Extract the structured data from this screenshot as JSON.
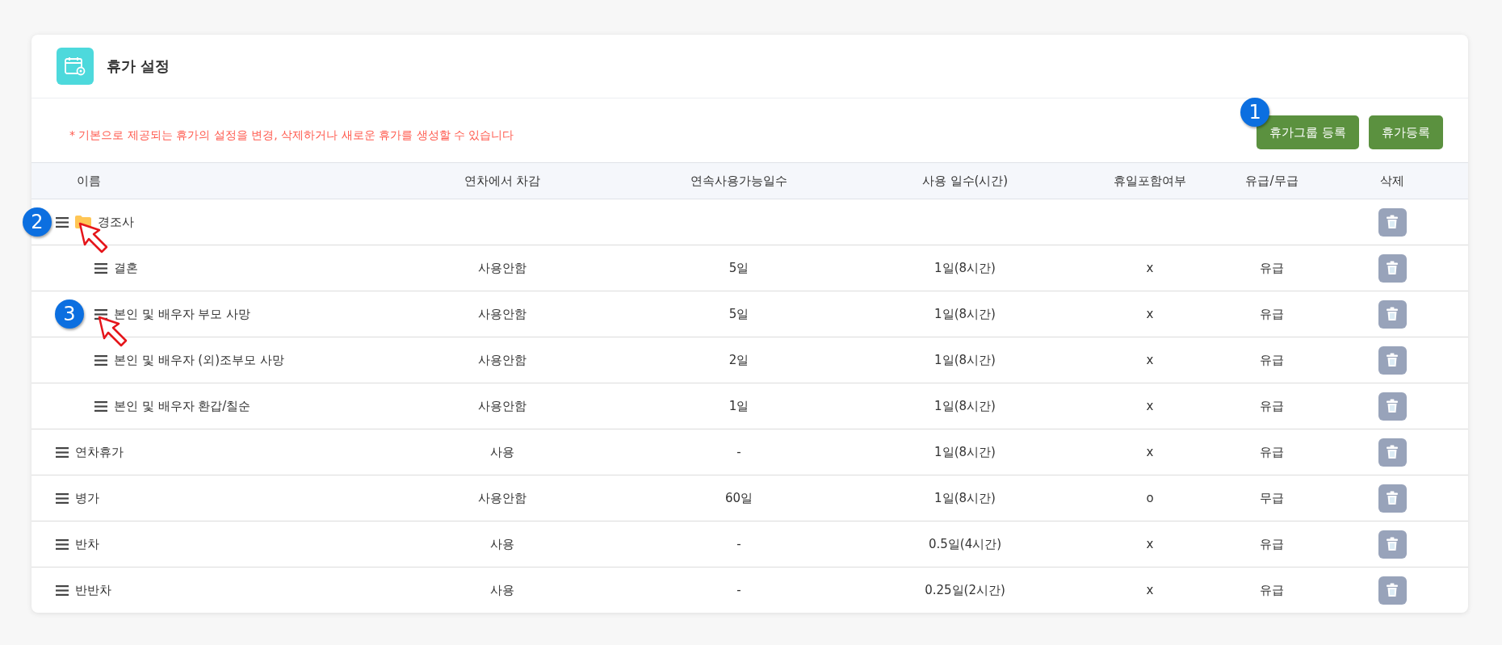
{
  "panel": {
    "title": "휴가 설정"
  },
  "notice": "* 기본으로 제공되는 휴가의 설정을 변경, 삭제하거나 새로운 휴가를 생성할 수 있습니다",
  "buttons": [
    {
      "label": "휴가그룹 등록",
      "callout": "1"
    },
    {
      "label": "휴가등록"
    }
  ],
  "table": {
    "columns": [
      "이름",
      "연차에서 차감",
      "연속사용가능일수",
      "사용 일수(시간)",
      "휴일포함여부",
      "유급/무급",
      "삭제"
    ],
    "rows": [
      {
        "kind": "group",
        "name": "경조사",
        "callout": "2",
        "children": [
          {
            "kind": "item",
            "name": "결혼",
            "deduct": "사용안함",
            "consecutive": "5일",
            "days": "1일(8시간)",
            "holiday": "x",
            "paid": "유급"
          },
          {
            "kind": "item",
            "name": "본인 및 배우자 부모 사망",
            "callout": "3",
            "deduct": "사용안함",
            "consecutive": "5일",
            "days": "1일(8시간)",
            "holiday": "x",
            "paid": "유급"
          },
          {
            "kind": "item",
            "name": "본인 및 배우자 (외)조부모 사망",
            "deduct": "사용안함",
            "consecutive": "2일",
            "days": "1일(8시간)",
            "holiday": "x",
            "paid": "유급"
          },
          {
            "kind": "item",
            "name": "본인 및 배우자 환갑/칠순",
            "deduct": "사용안함",
            "consecutive": "1일",
            "days": "1일(8시간)",
            "holiday": "x",
            "paid": "유급"
          }
        ]
      },
      {
        "kind": "item",
        "name": "연차휴가",
        "deduct": "사용",
        "consecutive": "-",
        "days": "1일(8시간)",
        "holiday": "x",
        "paid": "유급"
      },
      {
        "kind": "item",
        "name": "병가",
        "deduct": "사용안함",
        "consecutive": "60일",
        "days": "1일(8시간)",
        "holiday": "o",
        "paid": "무급"
      },
      {
        "kind": "item",
        "name": "반차",
        "deduct": "사용",
        "consecutive": "-",
        "days": "0.5일(4시간)",
        "holiday": "x",
        "paid": "유급"
      },
      {
        "kind": "item",
        "name": "반반차",
        "deduct": "사용",
        "consecutive": "-",
        "days": "0.25일(2시간)",
        "holiday": "x",
        "paid": "유급"
      }
    ]
  }
}
